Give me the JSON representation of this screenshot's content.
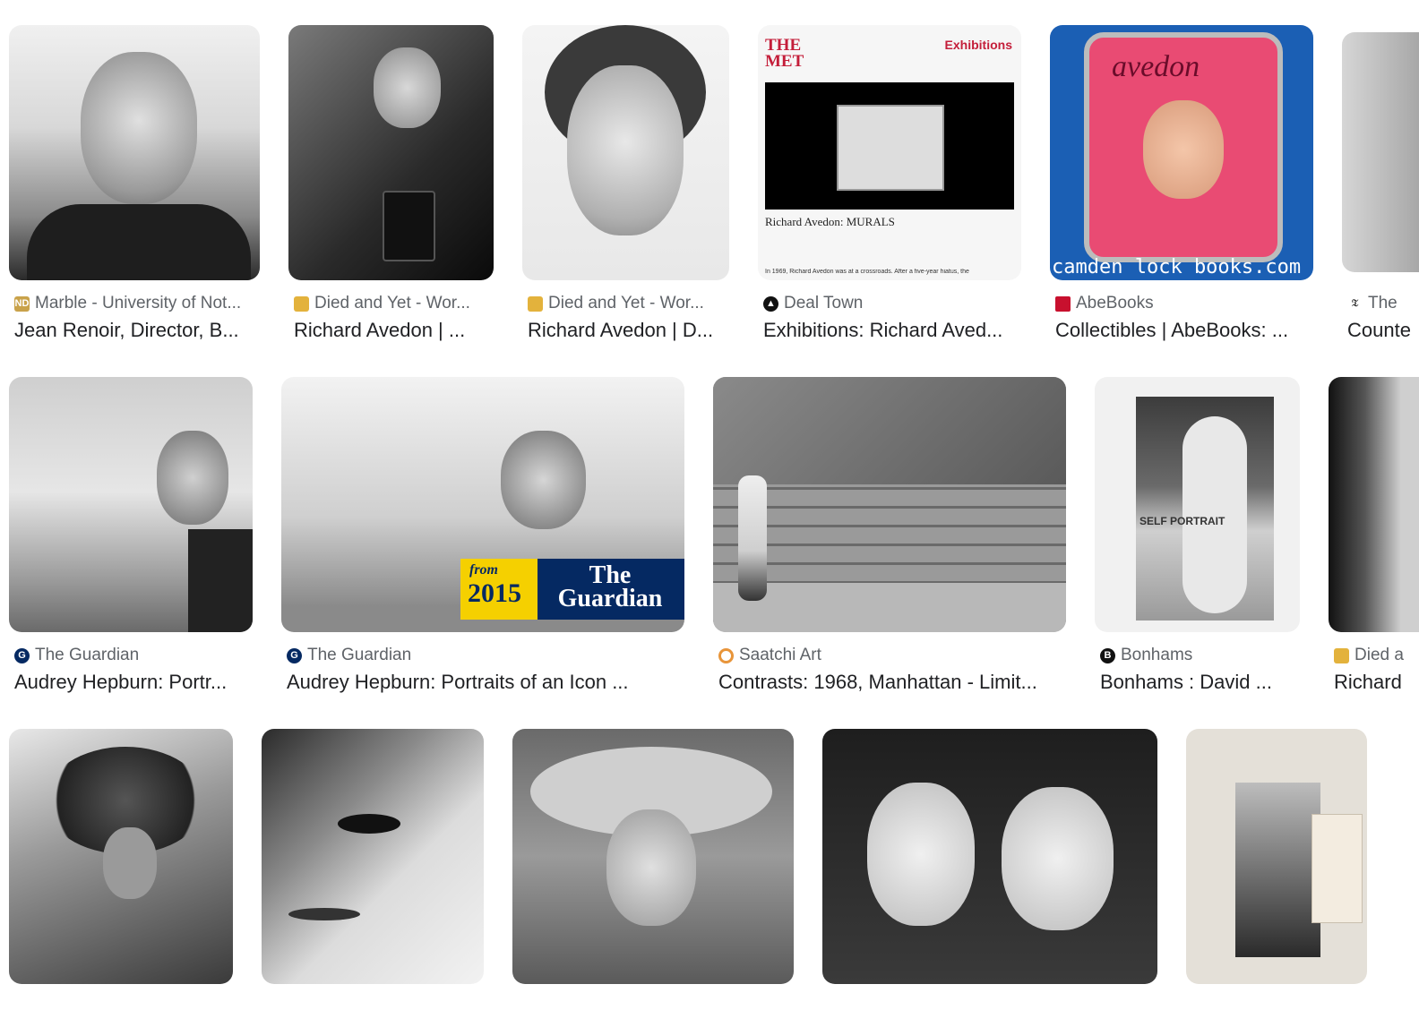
{
  "results": [
    {
      "source": "Marble - University of Not...",
      "title": "Jean Renoir, Director, B...",
      "icon": "notre-dame-icon",
      "fav_color": "#c9a24a"
    },
    {
      "source": "Died and Yet - Wor...",
      "title": "Richard Avedon | ...",
      "icon": "died-and-yet-icon",
      "fav_color": "#e3b23c"
    },
    {
      "source": "Died and Yet - Wor...",
      "title": "Richard Avedon | D...",
      "icon": "died-and-yet-icon",
      "fav_color": "#e3b23c"
    },
    {
      "source": "Deal Town",
      "title": "Exhibitions: Richard Aved...",
      "icon": "deal-town-icon",
      "fav_color": "#111111"
    },
    {
      "source": "AbeBooks",
      "title": "Collectibles | AbeBooks: ...",
      "icon": "abebooks-icon",
      "fav_color": "#c8102e"
    },
    {
      "source": "The",
      "title": "Counte",
      "icon": "nyt-icon",
      "fav_color": "#222222"
    },
    {
      "source": "The Guardian",
      "title": "Audrey Hepburn: Portr...",
      "icon": "guardian-icon",
      "fav_color": "#052962"
    },
    {
      "source": "The Guardian",
      "title": "Audrey Hepburn: Portraits of an Icon ...",
      "icon": "guardian-icon",
      "fav_color": "#052962"
    },
    {
      "source": "Saatchi Art",
      "title": "Contrasts: 1968, Manhattan - Limit...",
      "icon": "saatchi-icon",
      "fav_color": "#e8953a"
    },
    {
      "source": "Bonhams",
      "title": "Bonhams : David ...",
      "icon": "bonhams-icon",
      "fav_color": "#111111"
    },
    {
      "source": "Died a",
      "title": "Richard",
      "icon": "died-and-yet-icon",
      "fav_color": "#e3b23c"
    }
  ],
  "thumb_text": {
    "met_logo": "THE MET",
    "met_exhibitions": "Exhibitions",
    "met_caption": "Richard Avedon: MURALS",
    "met_body": "In 1969, Richard Avedon was at a crossroads. After a five-year hiatus, the",
    "camden": "camden lock books.com",
    "avedon_script": "avedon",
    "guardian_year": "2015",
    "guardian_from": "from",
    "guardian_name": "The Guardian",
    "self_portrait": "SELF PORTRAIT"
  }
}
